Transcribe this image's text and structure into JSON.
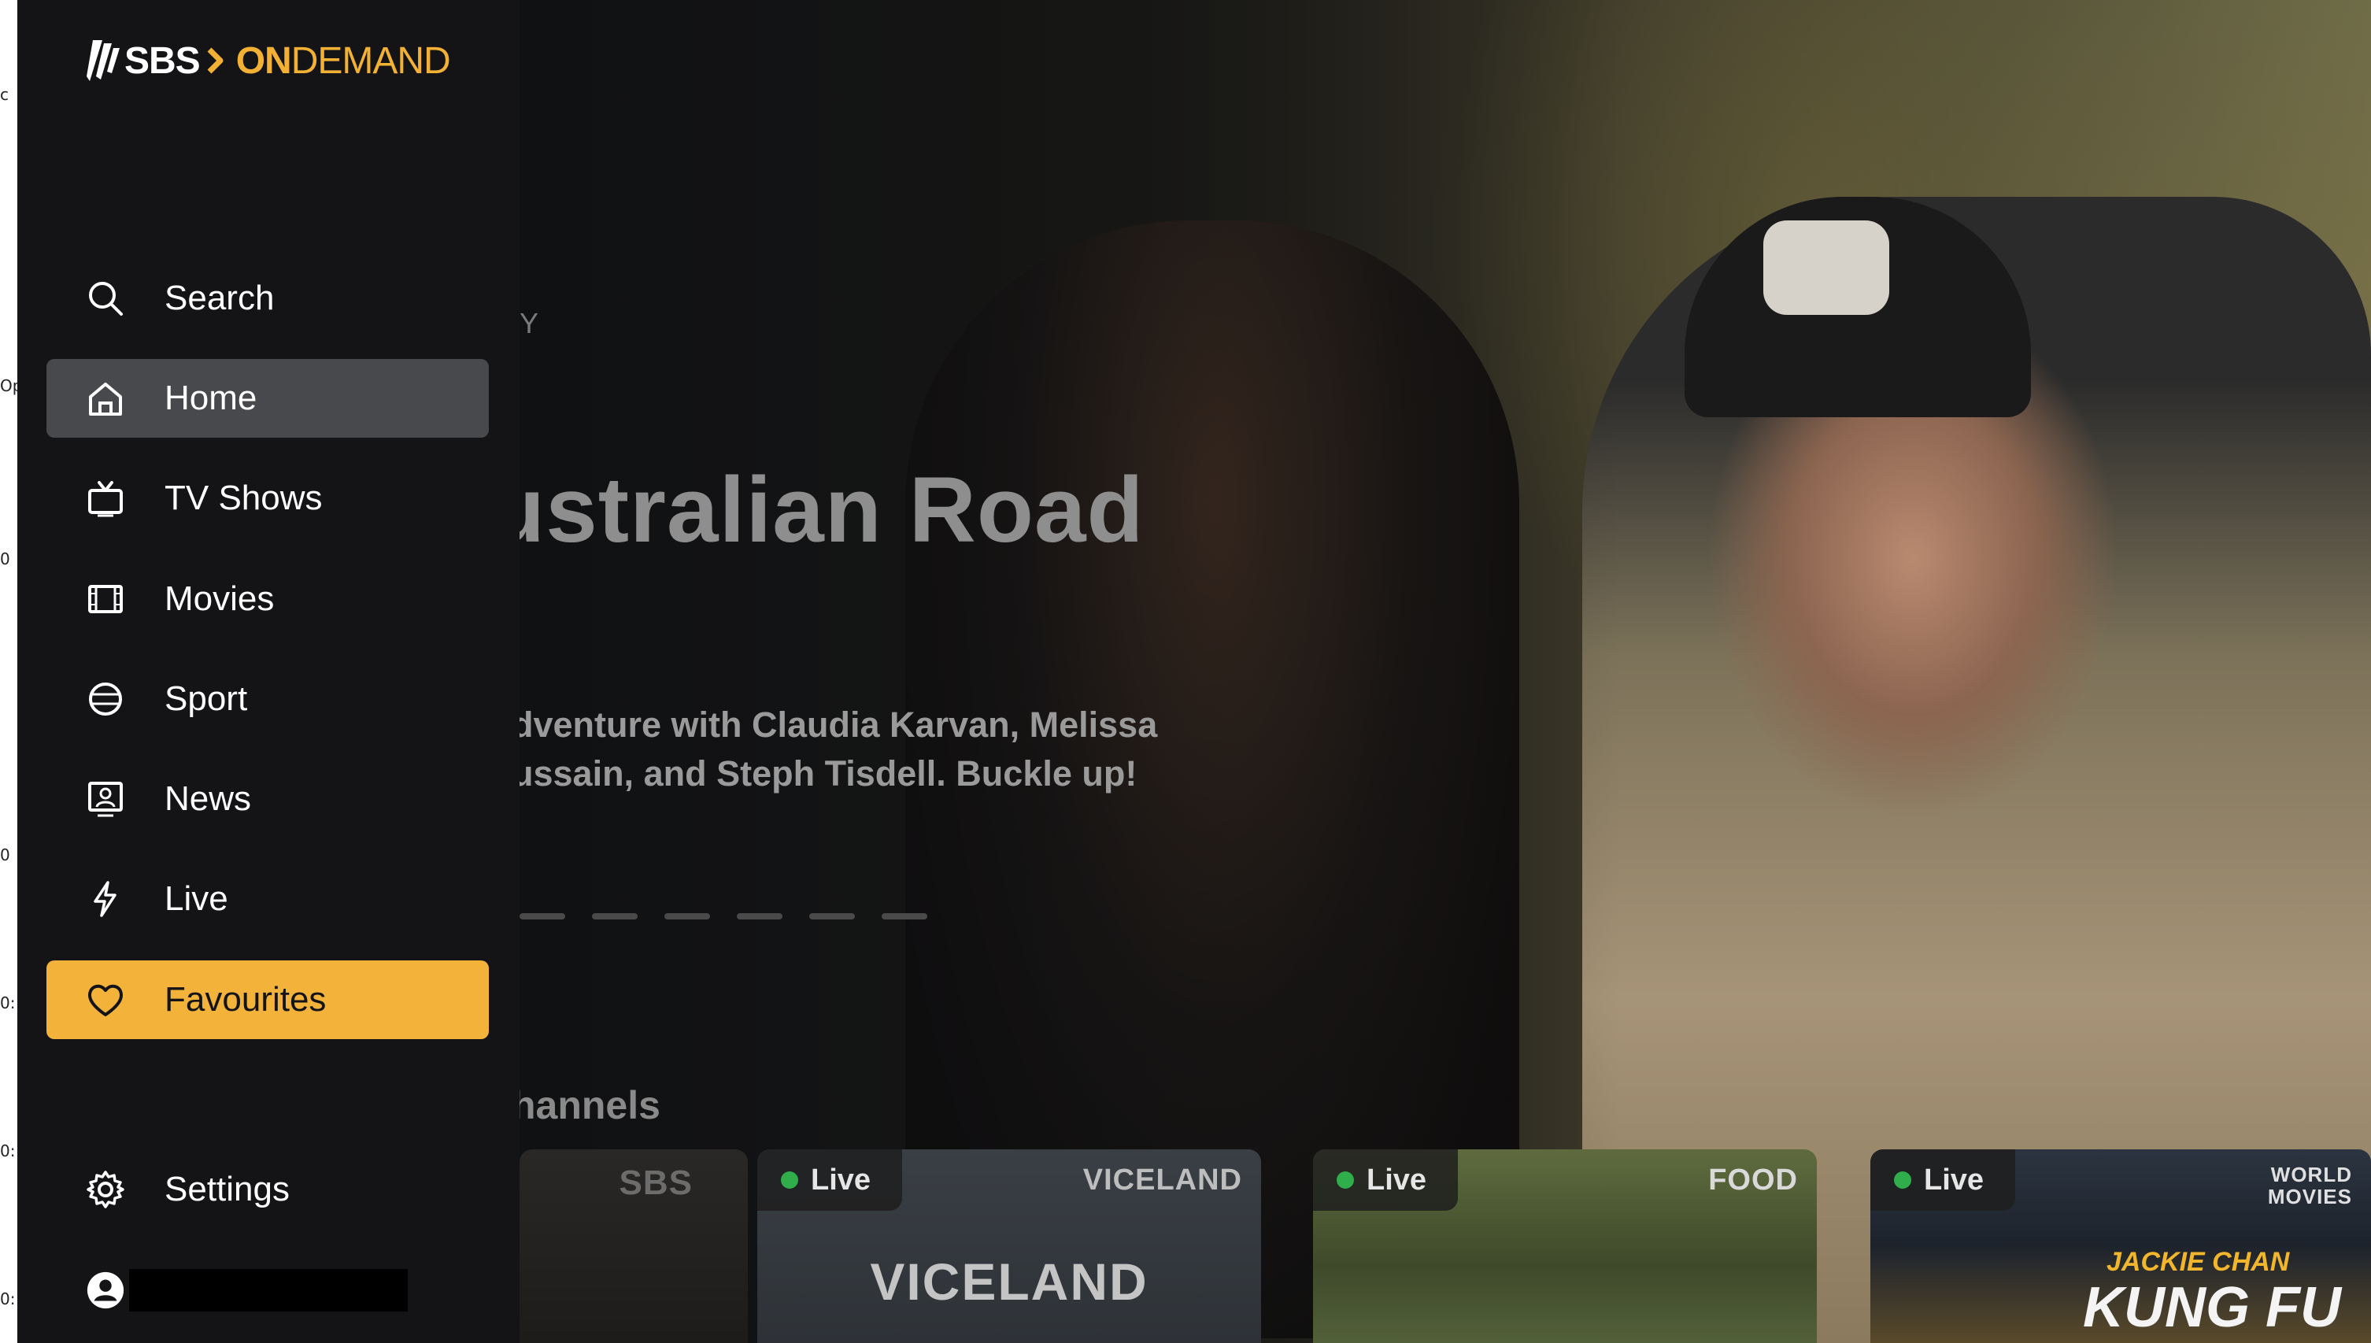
{
  "sliver": {
    "glyphs": [
      "c",
      "Op",
      "0",
      "0",
      "0:",
      "0:",
      "0:"
    ]
  },
  "brand": {
    "logo_sbs": "SBS",
    "logo_on": "ON",
    "logo_demand": "DEMAND"
  },
  "sidebar": {
    "items": [
      {
        "label": "Search",
        "icon": "search-icon"
      },
      {
        "label": "Home",
        "icon": "home-icon",
        "state": "highlighted"
      },
      {
        "label": "TV Shows",
        "icon": "tv-icon"
      },
      {
        "label": "Movies",
        "icon": "film-icon"
      },
      {
        "label": "Sport",
        "icon": "ball-icon"
      },
      {
        "label": "News",
        "icon": "news-presenter-icon"
      },
      {
        "label": "Live",
        "icon": "lightning-icon"
      },
      {
        "label": "Favourites",
        "icon": "heart-icon",
        "state": "selected"
      }
    ],
    "settings_label": "Settings",
    "settings_icon": "gear-icon",
    "profile_icon": "user-avatar-icon"
  },
  "hero": {
    "eyebrow": "Y",
    "title": "ustralian Road",
    "description_line1": "dventure with Claudia Karvan, Melissa",
    "description_line2": "ussain, and Steph Tisdell. Buckle up!",
    "pager_count": 6
  },
  "channels": {
    "heading": "hannels",
    "tiles": [
      {
        "brand": "SBS",
        "live": ""
      },
      {
        "brand": "VICELAND",
        "live": "Live",
        "center": "VICELAND"
      },
      {
        "brand": "FOOD",
        "live": "Live"
      },
      {
        "brand": "WORLD MOVIES",
        "live": "Live",
        "promo_small": "JACKIE CHAN",
        "promo_big": "KUNG FU"
      }
    ]
  },
  "colors": {
    "sidebar_bg": "#141417",
    "accent_yellow": "#f3b23a",
    "highlight_gray": "#48494c",
    "live_green": "#2fae4b"
  }
}
